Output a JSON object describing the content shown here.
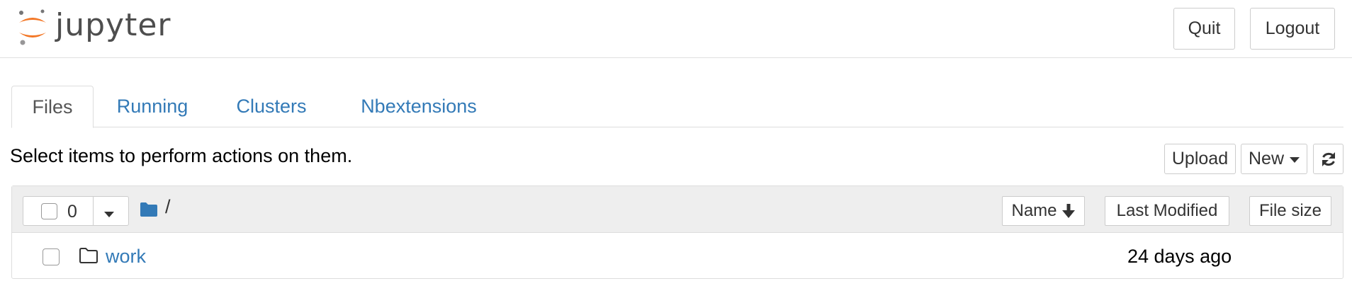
{
  "header": {
    "logo_text": "jupyter",
    "quit_label": "Quit",
    "logout_label": "Logout"
  },
  "tabs": [
    {
      "label": "Files",
      "active": true
    },
    {
      "label": "Running",
      "active": false
    },
    {
      "label": "Clusters",
      "active": false
    },
    {
      "label": "Nbextensions",
      "active": false
    }
  ],
  "toolbar": {
    "hint": "Select items to perform actions on them.",
    "upload_label": "Upload",
    "new_label": "New",
    "refresh_icon": "refresh-icon"
  },
  "file_list": {
    "selected_count": "0",
    "breadcrumb": "/",
    "columns": {
      "name": "Name",
      "last_modified": "Last Modified",
      "file_size": "File size"
    },
    "rows": [
      {
        "name": "work",
        "type": "folder",
        "last_modified": "24 days ago"
      }
    ]
  },
  "colors": {
    "link": "#337ab7",
    "jupyter_orange": "#f37726",
    "folder_blue": "#337ab7"
  }
}
